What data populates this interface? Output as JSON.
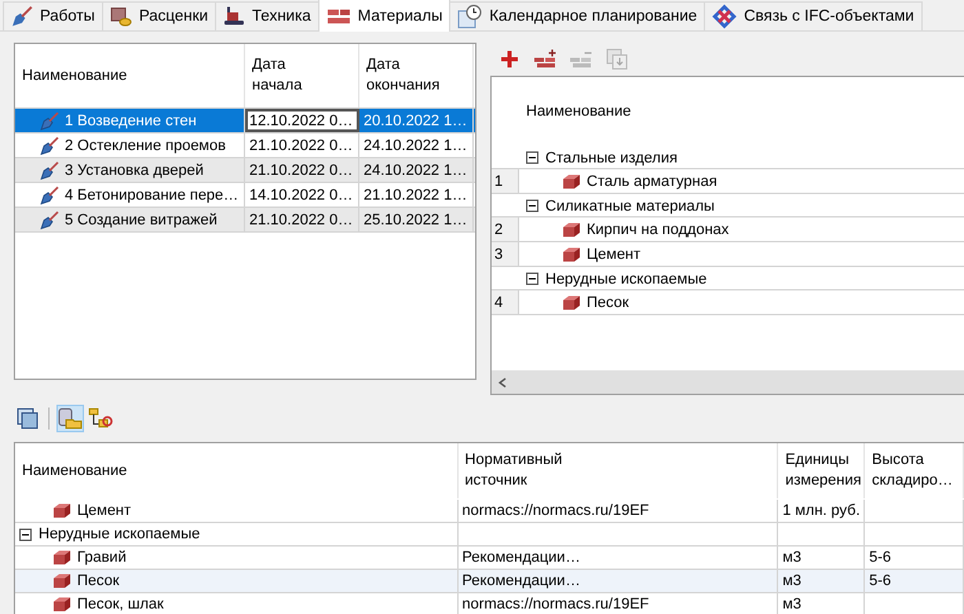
{
  "tabs": [
    {
      "label": "Работы",
      "selected": false
    },
    {
      "label": "Расценки",
      "selected": false
    },
    {
      "label": "Техника",
      "selected": false
    },
    {
      "label": "Материалы",
      "selected": true
    },
    {
      "label": "Календарное планирование",
      "selected": false
    },
    {
      "label": "Связь с IFC-объектами",
      "selected": false
    }
  ],
  "works_table": {
    "columns": [
      "Наименование",
      "Дата\nначала",
      "Дата\nокончания"
    ],
    "rows": [
      {
        "name": "1 Возведение стен",
        "start": "12.10.2022 0…",
        "end": "20.10.2022 1…",
        "selected": true
      },
      {
        "name": "2 Остекление проемов",
        "start": "21.10.2022 0…",
        "end": "24.10.2022 1…",
        "selected": false
      },
      {
        "name": "3 Установка дверей",
        "start": "21.10.2022 0…",
        "end": "24.10.2022 1…",
        "selected": false
      },
      {
        "name": "4 Бетонирование пере…",
        "start": "14.10.2022 0…",
        "end": "21.10.2022 1…",
        "selected": false
      },
      {
        "name": "5 Создание витражей",
        "start": "21.10.2022 0…",
        "end": "25.10.2022 1…",
        "selected": false
      }
    ]
  },
  "materials_toolbar": [
    {
      "disabled": false
    },
    {
      "disabled": false
    },
    {
      "disabled": true
    },
    {
      "disabled": true
    }
  ],
  "materials_tree": {
    "column": "Наименование",
    "groups": [
      {
        "name": "Стальные изделия",
        "expanded": true,
        "children": [
          {
            "number": "1",
            "name": "Сталь арматурная"
          }
        ]
      },
      {
        "name": "Силикатные материалы",
        "expanded": true,
        "children": [
          {
            "number": "2",
            "name": "Кирпич на поддонах"
          },
          {
            "number": "3",
            "name": "Цемент"
          }
        ]
      },
      {
        "name": "Нерудные ископаемые",
        "expanded": true,
        "children": [
          {
            "number": "4",
            "name": "Песок"
          }
        ]
      }
    ]
  },
  "bottom_toolbar": [
    {
      "selected": false
    },
    {
      "selected": true
    },
    {
      "selected": false
    }
  ],
  "resources_table": {
    "columns": [
      "Наименование",
      "Нормативный\nисточник",
      "Единицы\nизмерения",
      "Высота\nскладиро…"
    ],
    "rows": [
      {
        "kind": "item",
        "name": "Цемент",
        "source": "normacs://normacs.ru/19EF",
        "units": "1 млн. руб.",
        "selected": false
      },
      {
        "kind": "group",
        "name": "Нерудные ископаемые",
        "expanded": true,
        "children": [
          {
            "kind": "item",
            "name": "Гравий",
            "source": "Рекомендации…",
            "units": "м3",
            "height": "5-6",
            "selected": false
          },
          {
            "kind": "item",
            "name": "Песок",
            "source": "Рекомендации…",
            "units": "м3",
            "height": "5-6",
            "selected": true
          },
          {
            "kind": "item",
            "name": "Песок, шлак",
            "source": "normacs://normacs.ru/19EF",
            "units": "м3",
            "selected": false
          }
        ]
      }
    ]
  }
}
